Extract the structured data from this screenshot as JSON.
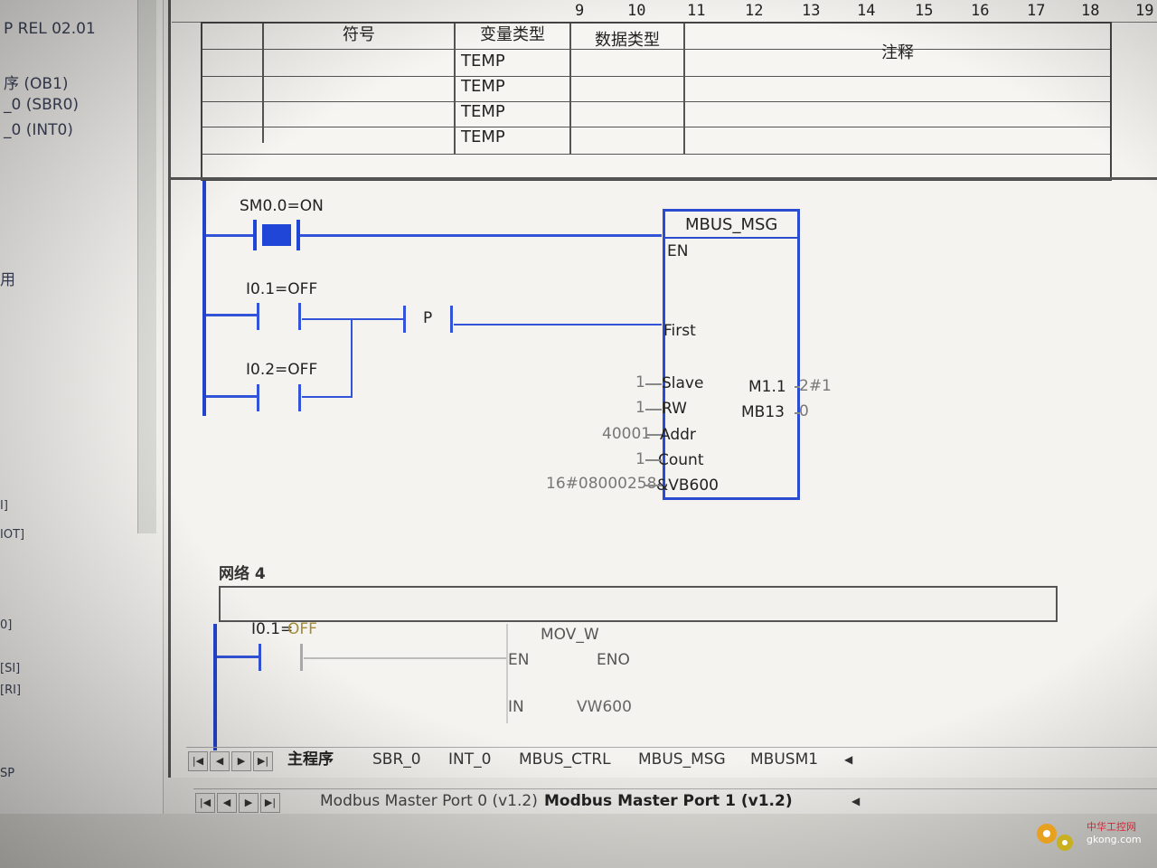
{
  "tree": {
    "lines": [
      "P REL 02.01",
      "序 (OB1)",
      "_0 (SBR0)",
      "_0 (INT0)",
      "用",
      "I]",
      "IOT]",
      "0]",
      "[SI]",
      "[RI]",
      "SP"
    ]
  },
  "ruler": {
    "ticks": [
      "9",
      "10",
      "11",
      "12",
      "13",
      "14",
      "15",
      "16",
      "17",
      "18",
      "19"
    ]
  },
  "var_table": {
    "headers": [
      "符号",
      "变量类型",
      "数据类型",
      "注释"
    ],
    "rows": [
      "TEMP",
      "TEMP",
      "TEMP",
      "TEMP"
    ]
  },
  "network3": {
    "contact1": "SM0.0=ON",
    "contact2": "I0.1=OFF",
    "contact3": "I0.2=OFF",
    "p_label": "P",
    "block": {
      "title": "MBUS_MSG",
      "inputs": [
        "EN",
        "First",
        "Slave",
        "RW",
        "Addr",
        "Count",
        "&VB600"
      ],
      "input_values": [
        "1",
        "1",
        "40001",
        "1",
        "16#08000258"
      ],
      "outputs": [
        "M1.1",
        "MB13"
      ],
      "output_values": [
        "2#1",
        "0"
      ]
    }
  },
  "network4": {
    "title": "网络 4",
    "contact": "I0.1=",
    "contact_state": "OFF",
    "block": {
      "title": "MOV_W",
      "en": "EN",
      "eno": "ENO",
      "in": "IN",
      "in_value": "VW600"
    }
  },
  "tabs_program": [
    "主程序",
    "SBR_0",
    "INT_0",
    "MBUS_CTRL",
    "MBUS_MSG",
    "MBUSM1"
  ],
  "tabs_library": [
    "Modbus Master Port 0 (v1.2)",
    "Modbus Master Port 1 (v1.2)"
  ],
  "watermark": {
    "cn": "中华工控网",
    "url": "gkong.com"
  },
  "colors": {
    "ladder_blue": "#2b4ccf",
    "contact_on": "#1f46d6",
    "background": "#ecebe7"
  }
}
